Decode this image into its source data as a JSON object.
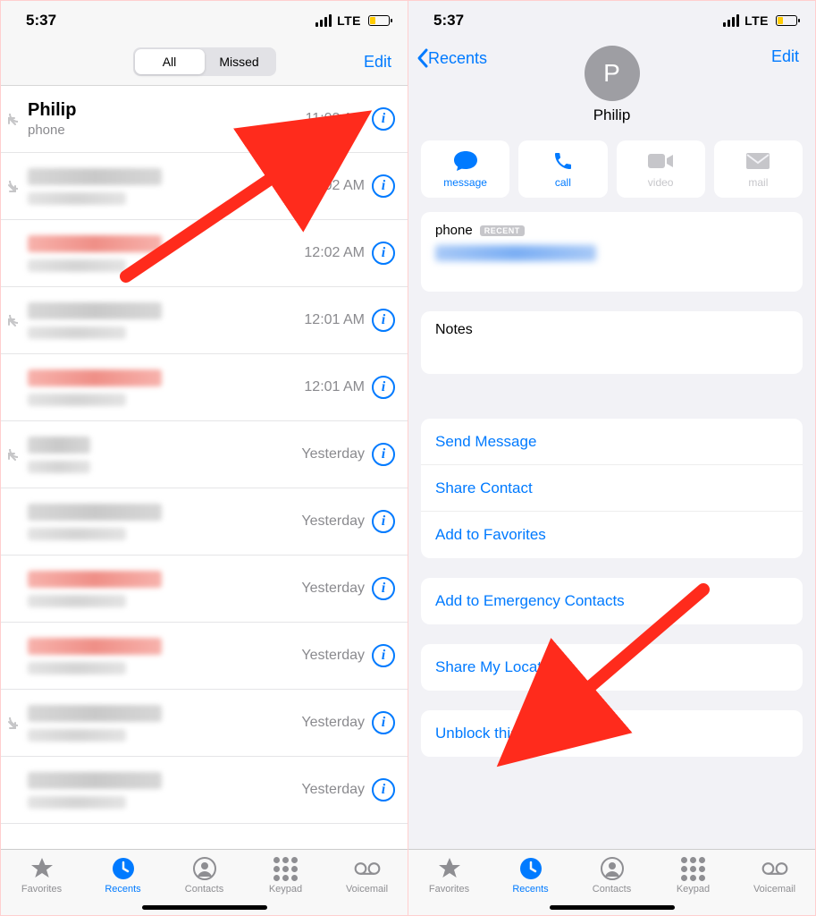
{
  "status": {
    "time": "5:37",
    "network": "LTE"
  },
  "left": {
    "segmented": {
      "all": "All",
      "missed": "Missed",
      "active": "all"
    },
    "edit": "Edit",
    "calls": [
      {
        "name": "Philip",
        "sub": "phone",
        "time": "11:03 AM",
        "missed": false,
        "blurred": false,
        "icon": "incoming"
      },
      {
        "time": "12:02 AM",
        "missed": false,
        "blurred": true,
        "icon": "outgoing"
      },
      {
        "time": "12:02 AM",
        "missed": true,
        "blurred": true,
        "icon": ""
      },
      {
        "time": "12:01 AM",
        "missed": false,
        "blurred": true,
        "icon": "incoming"
      },
      {
        "time": "12:01 AM",
        "missed": true,
        "blurred": true,
        "icon": ""
      },
      {
        "time": "Yesterday",
        "missed": false,
        "blurred": true,
        "icon": "incoming",
        "short": true
      },
      {
        "time": "Yesterday",
        "missed": false,
        "blurred": true,
        "icon": ""
      },
      {
        "time": "Yesterday",
        "missed": true,
        "blurred": true,
        "icon": ""
      },
      {
        "time": "Yesterday",
        "missed": true,
        "blurred": true,
        "icon": ""
      },
      {
        "time": "Yesterday",
        "missed": false,
        "blurred": true,
        "icon": "outgoing"
      },
      {
        "time": "Yesterday",
        "missed": false,
        "blurred": true,
        "icon": ""
      }
    ]
  },
  "tabs": {
    "favorites": "Favorites",
    "recents": "Recents",
    "contacts": "Contacts",
    "keypad": "Keypad",
    "voicemail": "Voicemail",
    "active": "recents"
  },
  "right": {
    "back": "Recents",
    "edit": "Edit",
    "avatarInitial": "P",
    "name": "Philip",
    "actions": {
      "message": "message",
      "call": "call",
      "video": "video",
      "mail": "mail"
    },
    "phoneLabel": "phone",
    "recentBadge": "RECENT",
    "notesLabel": "Notes",
    "group1": [
      "Send Message",
      "Share Contact",
      "Add to Favorites"
    ],
    "group2": [
      "Add to Emergency Contacts"
    ],
    "group3": [
      "Share My Location"
    ],
    "group4": [
      "Unblock this Caller"
    ]
  }
}
